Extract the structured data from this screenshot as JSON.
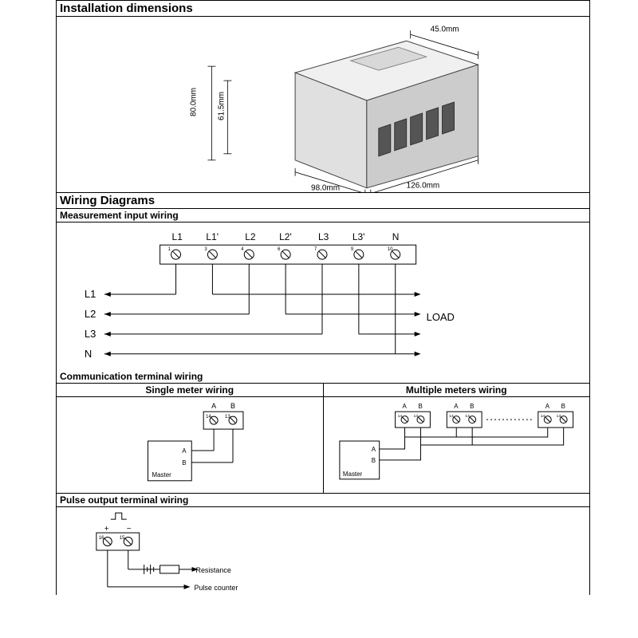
{
  "sections": {
    "install": "Installation dimensions",
    "wiring": "Wiring Diagrams",
    "measure": "Measurement input wiring",
    "comm": "Communication terminal wiring",
    "single": "Single meter wiring",
    "multi": "Multiple meters wiring",
    "pulse": "Pulse output terminal wiring"
  },
  "dims": {
    "d1": "45.0mm",
    "d2": "80.0mm",
    "d3": "61.5mm",
    "d4": "98.0mm",
    "d5": "126.0mm"
  },
  "terminals": {
    "top": [
      {
        "lbl": "L1",
        "n": "1"
      },
      {
        "lbl": "L1'",
        "n": "3"
      },
      {
        "lbl": "L2",
        "n": "4"
      },
      {
        "lbl": "L2'",
        "n": "6"
      },
      {
        "lbl": "L3",
        "n": "7"
      },
      {
        "lbl": "L3'",
        "n": "9"
      },
      {
        "lbl": "N",
        "n": "10"
      }
    ],
    "inputs": [
      "L1",
      "L2",
      "L3",
      "N"
    ],
    "load": "LOAD",
    "ab": {
      "a": "A",
      "b": "B",
      "t14": "14",
      "t13": "13"
    },
    "master": "Master",
    "pulse": {
      "t16": "16",
      "t15": "15",
      "plus": "+",
      "minus": "−",
      "res": "Resistance",
      "pc": "Pulse counter"
    }
  }
}
